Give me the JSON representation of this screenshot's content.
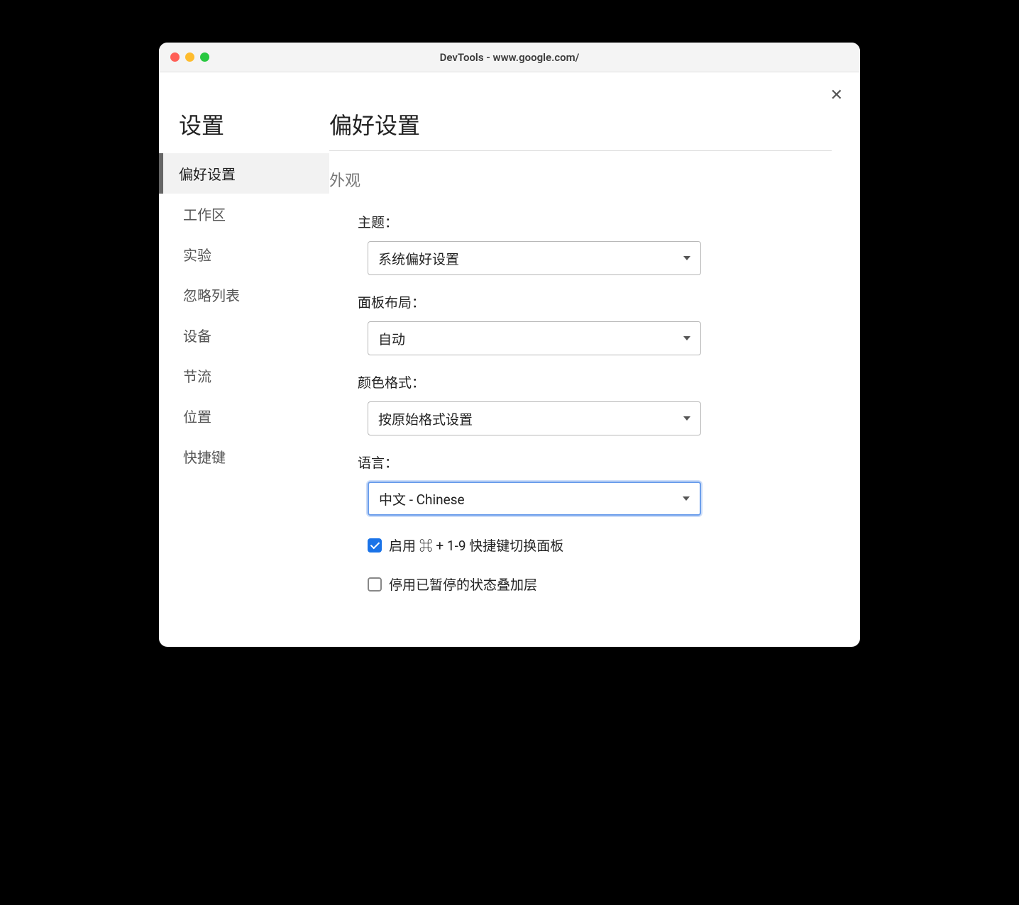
{
  "window": {
    "title": "DevTools - www.google.com/"
  },
  "sidebar": {
    "title": "设置",
    "items": [
      {
        "label": "偏好设置",
        "active": true
      },
      {
        "label": "工作区",
        "active": false
      },
      {
        "label": "实验",
        "active": false
      },
      {
        "label": "忽略列表",
        "active": false
      },
      {
        "label": "设备",
        "active": false
      },
      {
        "label": "节流",
        "active": false
      },
      {
        "label": "位置",
        "active": false
      },
      {
        "label": "快捷键",
        "active": false
      }
    ]
  },
  "main": {
    "title": "偏好设置",
    "section_title": "外观",
    "theme": {
      "label": "主题：",
      "value": "系统偏好设置"
    },
    "panel_layout": {
      "label": "面板布局：",
      "value": "自动"
    },
    "color_format": {
      "label": "颜色格式：",
      "value": "按原始格式设置"
    },
    "language": {
      "label": "语言：",
      "value": "中文 - Chinese"
    },
    "enable_shortcut": {
      "label": "启用 ⌘ + 1-9 快捷键切换面板",
      "checked": true
    },
    "disable_overlay": {
      "label": "停用已暂停的状态叠加层",
      "checked": false
    }
  }
}
